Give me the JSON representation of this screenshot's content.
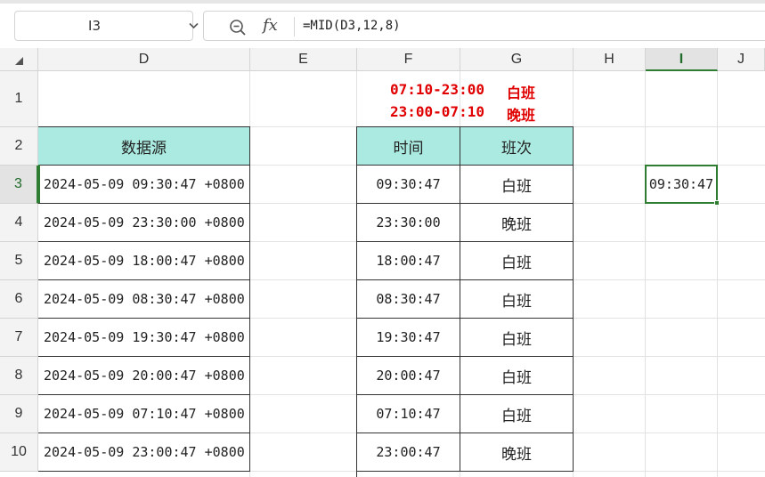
{
  "formula_bar": {
    "cell_reference": "I3",
    "fx_label": "fx",
    "formula": "=MID(D3,12,8)"
  },
  "columns": [
    "D",
    "E",
    "F",
    "G",
    "H",
    "I",
    "J"
  ],
  "rows": [
    "1",
    "2",
    "3",
    "4",
    "5",
    "6",
    "7",
    "8",
    "9",
    "10"
  ],
  "legend": {
    "line1_time": "07:10-23:00",
    "line1_shift": "白班",
    "line2_time": "23:00-07:10",
    "line2_shift": "晚班"
  },
  "table_source": {
    "header": "数据源",
    "values": [
      "2024-05-09 09:30:47 +0800",
      "2024-05-09 23:30:00 +0800",
      "2024-05-09 18:00:47 +0800",
      "2024-05-09 08:30:47 +0800",
      "2024-05-09 19:30:47 +0800",
      "2024-05-09 20:00:47 +0800",
      "2024-05-09 07:10:47 +0800",
      "2024-05-09 23:00:47 +0800"
    ]
  },
  "table_shift": {
    "time_header": "时间",
    "shift_header": "班次",
    "rows": [
      {
        "time": "09:30:47",
        "shift": "白班"
      },
      {
        "time": "23:30:00",
        "shift": "晚班"
      },
      {
        "time": "18:00:47",
        "shift": "白班"
      },
      {
        "time": "08:30:47",
        "shift": "白班"
      },
      {
        "time": "19:30:47",
        "shift": "白班"
      },
      {
        "time": "20:00:47",
        "shift": "白班"
      },
      {
        "time": "07:10:47",
        "shift": "白班"
      },
      {
        "time": "23:00:47",
        "shift": "晚班"
      }
    ]
  },
  "selected_cell_value": "09:30:47",
  "colors": {
    "header_fill": "#aaeae0",
    "selection": "#2e7d32",
    "legend_text": "#e00000"
  }
}
